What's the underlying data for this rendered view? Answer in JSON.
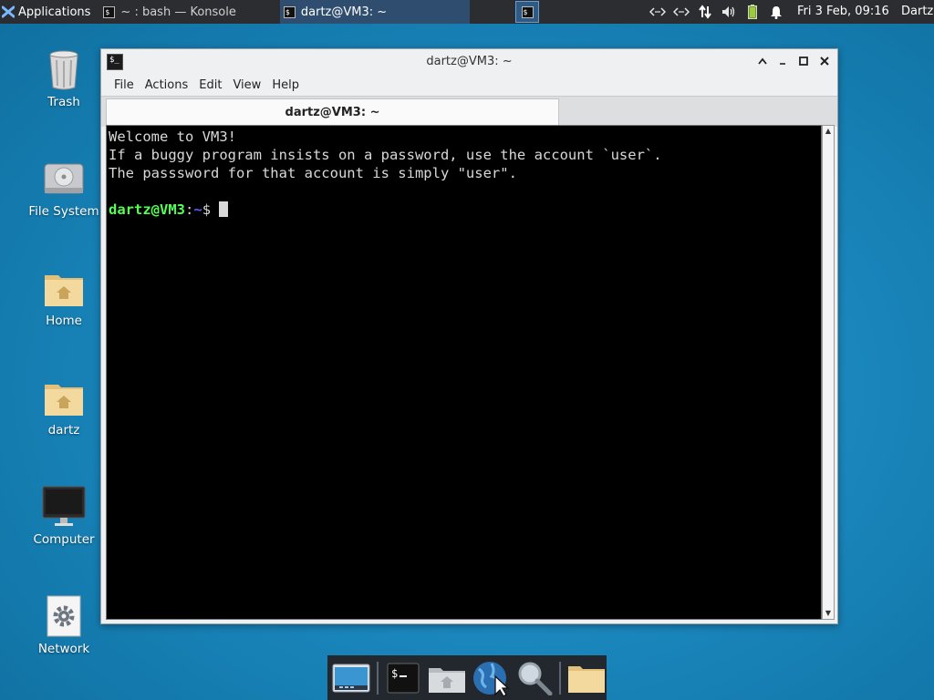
{
  "top_panel": {
    "app_menu_label": "Applications",
    "tasks": [
      {
        "label": "~ : bash — Konsole",
        "active": false
      },
      {
        "label": "dartz@VM3: ~",
        "active": true
      }
    ],
    "tray_icons": [
      "network-icon",
      "network-icon",
      "transfer-icon",
      "volume-icon",
      "battery-icon",
      "notification-bell-icon"
    ],
    "clock": "Fri  3 Feb, 09:16",
    "user": "Dartz"
  },
  "desktop": {
    "icons": [
      {
        "label": "Trash",
        "icon": "trash-icon"
      },
      {
        "label": "File System",
        "icon": "drive-icon"
      },
      {
        "label": "Home",
        "icon": "home-folder-icon"
      },
      {
        "label": "dartz",
        "icon": "home-folder-icon"
      },
      {
        "label": "Computer",
        "icon": "monitor-icon"
      },
      {
        "label": "Network",
        "icon": "gear-icon"
      }
    ]
  },
  "window": {
    "title": "dartz@VM3: ~",
    "menu": [
      "File",
      "Actions",
      "Edit",
      "View",
      "Help"
    ],
    "tab_label": "dartz@VM3: ~",
    "terminal": {
      "lines": [
        "Welcome to VM3!",
        "If a buggy program insists on a password, use the account `user`.",
        "The passsword for that account is simply \"user\"."
      ],
      "prompt_user": "dartz@VM3",
      "prompt_colon": ":",
      "prompt_path": "~",
      "prompt_symbol": "$ "
    }
  },
  "dock": {
    "items": [
      "show-desktop-icon",
      "terminal-icon",
      "home-icon",
      "web-browser-icon",
      "search-icon",
      "folder-icon"
    ]
  },
  "colors": {
    "desktop_bg": "#1a87bd",
    "panel_bg": "#2b2d30",
    "prompt_user": "#54ff54",
    "prompt_path": "#5c5cff",
    "terminal_bg": "#000000"
  }
}
